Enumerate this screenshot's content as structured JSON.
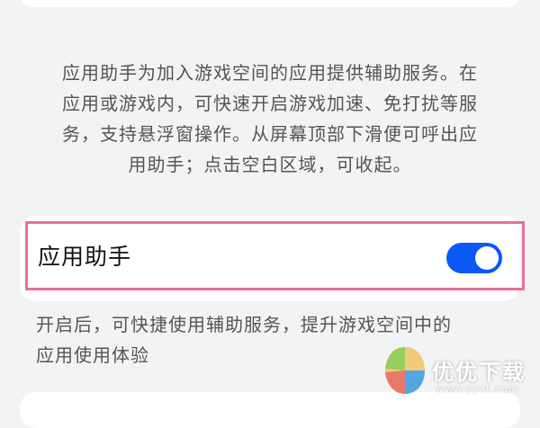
{
  "intro": {
    "line1": "应用助手为加入游戏空间的应用提供辅助服务。在",
    "line2": "应用或游戏内，可快速开启游戏加速、免打扰等服",
    "line3": "务，支持悬浮窗操作。从屏幕顶部下滑便可呼出应",
    "line4": "用助手；点击空白区域，可收起。"
  },
  "setting": {
    "label": "应用助手",
    "enabled": true,
    "accent_color": "#0a59f7",
    "highlight_color": "#e8709a"
  },
  "description": {
    "line1": "开启后，可快捷使用辅助服务，提升游戏空间中的",
    "line2": "应用使用体验"
  },
  "watermark": {
    "title": "优优下载",
    "url": "www.yyxt.com"
  }
}
